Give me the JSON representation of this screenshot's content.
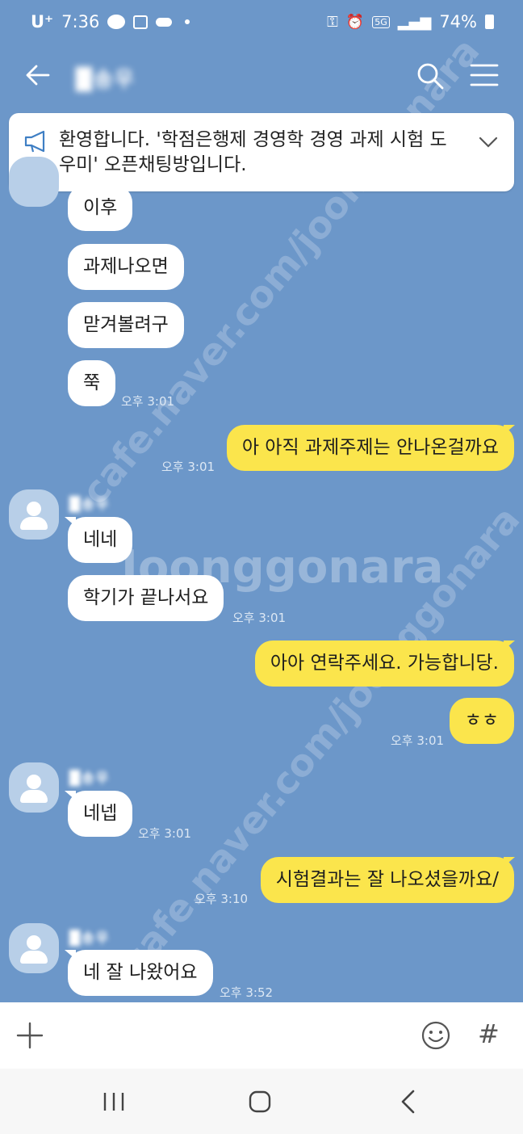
{
  "status_bar": {
    "carrier": "U⁺",
    "time": "7:36",
    "network": "5G",
    "battery": "74%"
  },
  "header": {
    "title": "█송우"
  },
  "notice": {
    "text": "환영합니다. '학점은행제 경영학 경영 과제 시험 도우미' 오픈채팅방입니다."
  },
  "messages": [
    {
      "side": "left",
      "text": "이후"
    },
    {
      "side": "left",
      "text": "과제나오면"
    },
    {
      "side": "left",
      "text": "맏겨볼려구"
    },
    {
      "side": "left",
      "text": "쭉",
      "time": "오후 3:01"
    },
    {
      "side": "right",
      "text": "아 아직 과제주제는 안나온걸까요",
      "time": "오후 3:01"
    },
    {
      "side": "left",
      "sender": "█송우",
      "text": "네네"
    },
    {
      "side": "left",
      "text": "학기가 끝나서요",
      "time": "오후 3:01"
    },
    {
      "side": "right",
      "text": "아아 연락주세요. 가능합니당."
    },
    {
      "side": "right",
      "text": "ㅎㅎ",
      "time": "오후 3:01"
    },
    {
      "side": "left",
      "sender": "█송우",
      "text": "네넵",
      "time": "오후 3:01"
    },
    {
      "side": "right",
      "text": "시험결과는 잘 나오셨을까요/",
      "time": "오후 3:10"
    },
    {
      "side": "left",
      "sender": "█송우",
      "text": "네 잘 나왔어요",
      "time": "오후 3:52"
    }
  ],
  "watermarks": [
    "cafe.naver.com/joonggonara",
    "Joonggonara"
  ],
  "input_bar": {
    "plus_icon": "plus-icon",
    "emoji_icon": "emoji-icon",
    "hash_label": "#"
  },
  "colors": {
    "background": "#6c97c9",
    "my_bubble": "#fbe54c",
    "other_bubble": "#ffffff"
  }
}
